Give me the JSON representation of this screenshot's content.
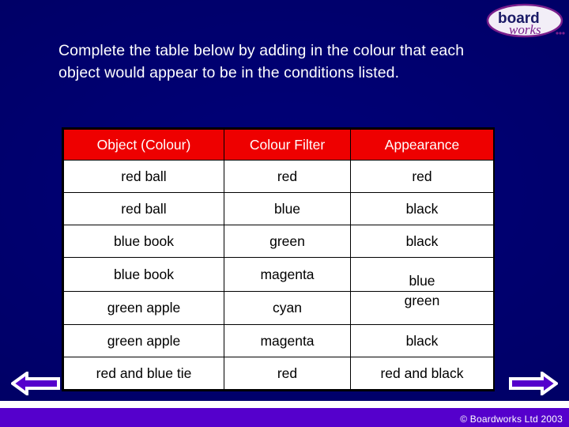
{
  "slide": {
    "background_color": "#000066",
    "prompt": "Complete the table below by adding in the colour that each object would appear to be in the conditions listed."
  },
  "logo": {
    "word_one": "board",
    "word_two": "works",
    "dots": "...",
    "ellipse_color": "#f2eef7",
    "outline_color": "#7a1f8c",
    "word_one_color": "#1a1a66",
    "word_two_color": "#7a1f8c"
  },
  "table": {
    "header_background": "#ee0000",
    "header_text_color": "#ffffff",
    "columns": [
      "Object (Colour)",
      "Colour Filter",
      "Appearance"
    ],
    "rows": [
      {
        "object": "red ball",
        "filter": "red",
        "appearance": "red",
        "appearance_align": "middle"
      },
      {
        "object": "red ball",
        "filter": "blue",
        "appearance": "black",
        "appearance_align": "middle"
      },
      {
        "object": "blue book",
        "filter": "green",
        "appearance": "black",
        "appearance_align": "middle"
      },
      {
        "object": "blue book",
        "filter": "magenta",
        "appearance": "blue",
        "appearance_align": "low"
      },
      {
        "object": "green apple",
        "filter": "cyan",
        "appearance": "green",
        "appearance_align": "high"
      },
      {
        "object": "green apple",
        "filter": "magenta",
        "appearance": "black",
        "appearance_align": "middle"
      },
      {
        "object": "red and blue tie",
        "filter": "red",
        "appearance": "red and black",
        "appearance_align": "middle"
      }
    ]
  },
  "footer": {
    "copyright": "© Boardworks Ltd 2003",
    "band_color": "#5500cc",
    "back_label": "Back",
    "next_label": "Next"
  }
}
